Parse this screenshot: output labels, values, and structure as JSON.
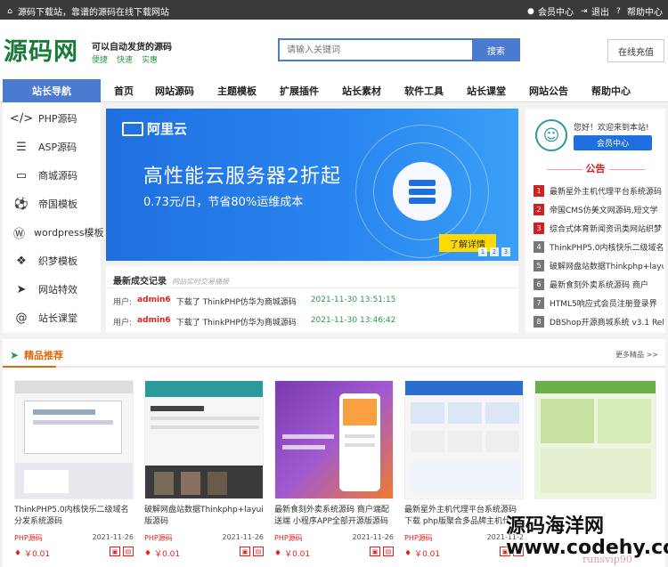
{
  "topbar": {
    "welcome": "源码下载站，靠谱的源码在线下载网站",
    "member": "会员中心",
    "logout": "退出",
    "help": "帮助中心"
  },
  "header": {
    "logo": "源码网",
    "slogan_main": "可以自动发货的源码",
    "slogan_tags": [
      "便捷",
      "快速",
      "实惠"
    ],
    "search_placeholder": "请输入关键词",
    "search_button": "搜索",
    "recharge": "在线充值"
  },
  "nav": {
    "home": "站长导航",
    "items": [
      "首页",
      "网站源码",
      "主题模板",
      "扩展插件",
      "站长素材",
      "软件工具",
      "站长课堂",
      "网站公告",
      "帮助中心"
    ]
  },
  "sidebar": {
    "items": [
      {
        "label": "PHP源码",
        "icon": "code-icon"
      },
      {
        "label": "ASP源码",
        "icon": "list-icon"
      },
      {
        "label": "商城源码",
        "icon": "monitor-icon"
      },
      {
        "label": "帝国模板",
        "icon": "ball-icon"
      },
      {
        "label": "wordpress模板",
        "icon": "wordpress-icon"
      },
      {
        "label": "织梦模板",
        "icon": "cubes-icon"
      },
      {
        "label": "网站特效",
        "icon": "send-icon"
      },
      {
        "label": "站长课堂",
        "icon": "at-icon"
      }
    ]
  },
  "banner": {
    "brand": "阿里云",
    "title": "高性能云服务器2折起",
    "subtitle": "0.73元/日，节省80%运维成本",
    "button": "了解详情",
    "dots": [
      "1",
      "2",
      "3"
    ]
  },
  "recent": {
    "title": "最新成交记录",
    "subtitle": "网站实时交易播报",
    "rows": [
      {
        "user_label": "用户:",
        "name": "admin6",
        "desc": "下载了 ThinkPHP仿华为商城源码",
        "time": "2021-11-30 13:51:15"
      },
      {
        "user_label": "用户:",
        "name": "admin6",
        "desc": "下载了 ThinkPHP仿华为商城源码",
        "time": "2021-11-30 13:46:42"
      }
    ]
  },
  "userpanel": {
    "greeting": "您好！欢迎来到本站!",
    "member_button": "会员中心",
    "notice_title": "公告",
    "news": [
      "最新星外主机代理平台系统源码",
      "帝国CMS仿美文网源码,短文学",
      "综合式体育新闻资讯类网站织梦",
      "ThinkPHP5.0内核快乐二级域名",
      "破解网盘站数据Thinkphp+layu",
      "最新食刻外卖系统源码 商户",
      "HTML5响应式会员注册登录界",
      "DBShop开源商城系统 v3.1 Rel"
    ]
  },
  "picks": {
    "title": "精品推荐",
    "more": "更多精品 >>",
    "cards": [
      {
        "title": "ThinkPHP5.0内核快乐二级域名分发系统源码",
        "cat": "PHP源码",
        "date": "2021-11-26",
        "price": "￥0.01"
      },
      {
        "title": "破解网盘站数据Thinkphp+layui版源码",
        "cat": "PHP源码",
        "date": "2021-11-26",
        "price": "￥0.01"
      },
      {
        "title": "最新食刻外卖系统源码 商户端配送端 小程序APP全部开源版源码",
        "cat": "PHP源码",
        "date": "2021-11-26",
        "price": "￥0.01"
      },
      {
        "title": "最新星外主机代理平台系统源码下载 php版聚合多品牌主机代理",
        "cat": "PHP源码",
        "date": "2021-11-2",
        "price": "￥0.01"
      },
      {
        "title": "",
        "cat": "",
        "date": "",
        "price": ""
      }
    ]
  },
  "watermark": {
    "line1": "源码海洋网",
    "line2": "www.codehy.com",
    "line3": "runsvip90"
  },
  "colors": {
    "accent": "#4a7bd0",
    "brand_green": "#1a7a3a",
    "notice_red": "#d02020",
    "pick_orange": "#e06a10"
  }
}
